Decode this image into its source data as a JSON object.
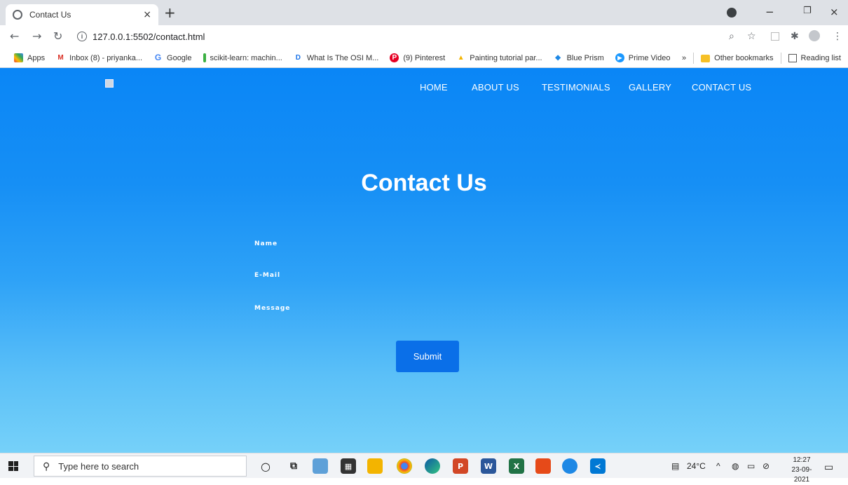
{
  "browser": {
    "tab_title": "Contact Us",
    "tab_close": "×",
    "new_tab": "+",
    "url": "127.0.0.1:5502/contact.html",
    "window_controls": {
      "minimize": "−",
      "restore": "❐",
      "close": "×"
    }
  },
  "bookmarks": {
    "items": [
      {
        "label": "Apps",
        "icon": "apps-grid-icon",
        "color": "#ea4335"
      },
      {
        "label": "Inbox (8) - priyanka...",
        "icon": "gmail-icon",
        "color": "#d93025"
      },
      {
        "label": "Google",
        "icon": "google-icon",
        "color": "#4285f4"
      },
      {
        "label": "scikit-learn: machin...",
        "icon": "scikit-icon",
        "color": "#3cb043"
      },
      {
        "label": "What Is The OSI M...",
        "icon": "d-logo-icon",
        "color": "#1a73e8"
      },
      {
        "label": "(9) Pinterest",
        "icon": "pinterest-icon",
        "color": "#e60023"
      },
      {
        "label": "Painting tutorial par...",
        "icon": "painting-icon",
        "color": "#f4b400"
      },
      {
        "label": "Blue Prism",
        "icon": "blue-prism-icon",
        "color": "#1e88e5"
      },
      {
        "label": "Prime Video",
        "icon": "prime-video-icon",
        "color": "#1a98ff"
      }
    ],
    "overflow": "»",
    "other_bookmarks": "Other bookmarks",
    "reading_list": "Reading list"
  },
  "page": {
    "nav": {
      "home": "HOME",
      "about": "ABOUT US",
      "testimonials": "TESTIMONIALS",
      "gallery": "GALLERY",
      "contact": "CONTACT US"
    },
    "heading": "Contact Us",
    "form": {
      "name_label": "Name",
      "email_label": "E-Mail",
      "message_label": "Message",
      "submit_label": "Submit"
    },
    "colors": {
      "gradient_top": "#0a86f6",
      "gradient_bottom": "#76d1f9",
      "button": "#0a6fe8"
    }
  },
  "taskbar": {
    "search_placeholder": "Type here to search",
    "weather": "24°C",
    "time": "12:27",
    "date": "23-09-2021"
  }
}
